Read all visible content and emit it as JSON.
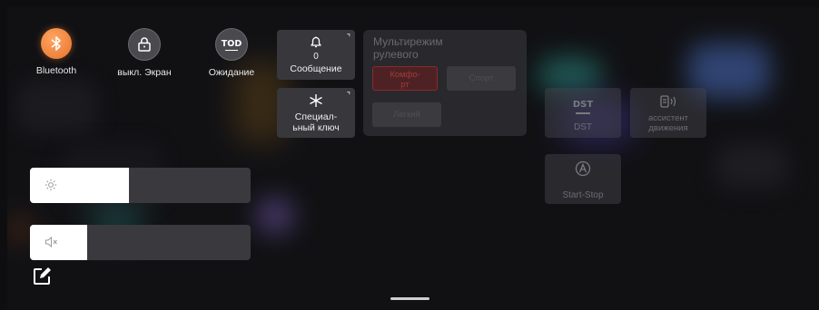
{
  "quick_toggles": [
    {
      "id": "bluetooth",
      "label": "Bluetooth",
      "icon": "bluetooth-icon",
      "active": true
    },
    {
      "id": "screen-off",
      "label": "выкл. Экран",
      "icon": "lock-icon",
      "active": false
    },
    {
      "id": "standby",
      "label": "Ожидание",
      "icon": "tod-icon",
      "icon_text": "TOD",
      "active": false
    }
  ],
  "tiles": {
    "message": {
      "label": "Сообщение",
      "count": "0"
    },
    "special_key": {
      "label": "Специал-\nьный ключ"
    }
  },
  "steering_mode": {
    "title": "Мультирежим\nрулевого",
    "options": [
      "Комфо-\nрт",
      "Спорт",
      "Легкий"
    ],
    "selected": "Комфо-\nрт"
  },
  "dst": {
    "icon_text": "DST",
    "label": "DST"
  },
  "driving_assist": {
    "label": "ассистент\nдвижения"
  },
  "start_stop": {
    "label": "Start-Stop"
  },
  "brightness": {
    "level": 0.45
  },
  "volume": {
    "level": 0.26,
    "muted": true
  },
  "colors": {
    "accent": "#ef7a33",
    "tile": "#38383c",
    "bg": "#111114"
  }
}
